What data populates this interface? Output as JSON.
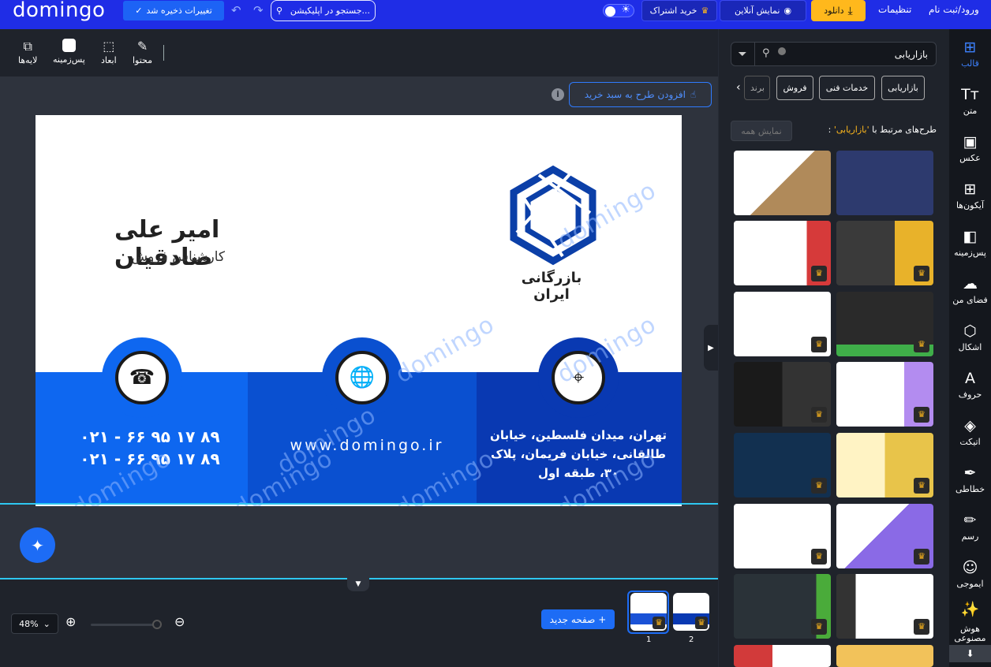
{
  "topbar": {
    "logo": "domingo",
    "save_label": "تغییرات ذخیره شد",
    "search_label": "جستجو در اپلیکیشن...",
    "subscribe_label": "خرید اشتراک",
    "preview_label": "نمایش آنلاین",
    "download_label": "دانلود",
    "settings_label": "تنظیمات",
    "login_label": "ورود/ثبت نام"
  },
  "toolbar": {
    "content": "محتوا",
    "dimensions": "ابعاد",
    "background": "پس‌زمینه",
    "layers": "لایه‌ها"
  },
  "canvas": {
    "add_to_cart": "افزودن طرح به سبد خرید",
    "watermark": "domingo"
  },
  "card": {
    "name": "امیر علی صادقیان",
    "role": "کارشناس فروش",
    "company": "بازرگانی ایران",
    "phone1": "۰۲۱ - ۶۶ ۹۵ ۱۷ ۸۹",
    "phone2": "۰۲۱ - ۶۶ ۹۵ ۱۷ ۸۹",
    "website": "www.domingo.ir",
    "address": "تهران، میدان فلسطین، خیابان طالقانی، خیابان فریمان، پلاک ۳۰، طبقه اول"
  },
  "bottom": {
    "zoom": "48%",
    "new_page": "صفحه جدید",
    "pages": [
      "1",
      "2"
    ]
  },
  "panel": {
    "search_value": "بازاریابی",
    "chips": [
      "بازاریابی",
      "خدمات فنی",
      "فروش",
      "برند"
    ],
    "related_prefix": "طرح‌های مرتبط با",
    "related_term": "'بازاریابی'",
    "related_suffix": ":",
    "show_all": "نمایش همه"
  },
  "iconbar": {
    "items": [
      "قالب",
      "متن",
      "عکس",
      "آیکون‌ها",
      "پس‌زمینه",
      "فضای من",
      "اشکال",
      "حروف",
      "اتیکت",
      "خطاطی",
      "رسم",
      "ایموجی",
      "هوش مصنوعی"
    ]
  },
  "colors": {
    "brand": "#1f2de6",
    "accent": "#1d6cf5",
    "gold": "#ffb81c"
  }
}
